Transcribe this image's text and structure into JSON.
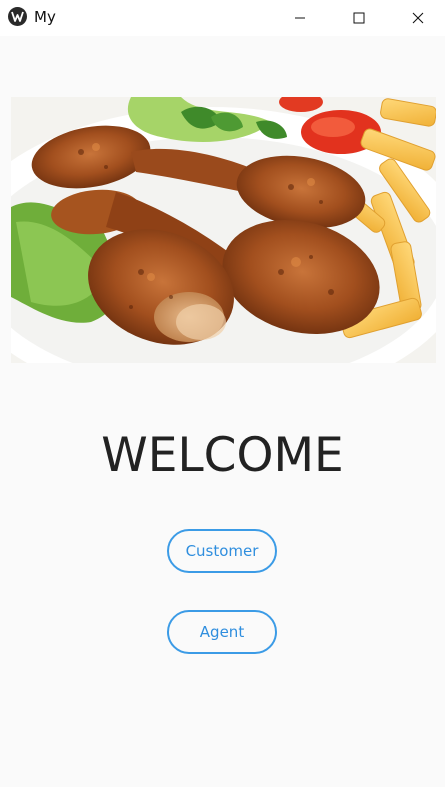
{
  "window": {
    "title": "My",
    "icon": "kivy-logo-icon",
    "controls": [
      "minimize-icon",
      "maximize-icon",
      "close-icon"
    ]
  },
  "hero": {
    "image": "fried-chicken-drumsticks-with-fries-and-salad"
  },
  "main": {
    "heading": "WELCOME",
    "buttons": {
      "customer_label": "Customer",
      "agent_label": "Agent"
    }
  },
  "colors": {
    "background": "#fafafa",
    "accent": "#3b9be6",
    "heading": "#222222"
  }
}
